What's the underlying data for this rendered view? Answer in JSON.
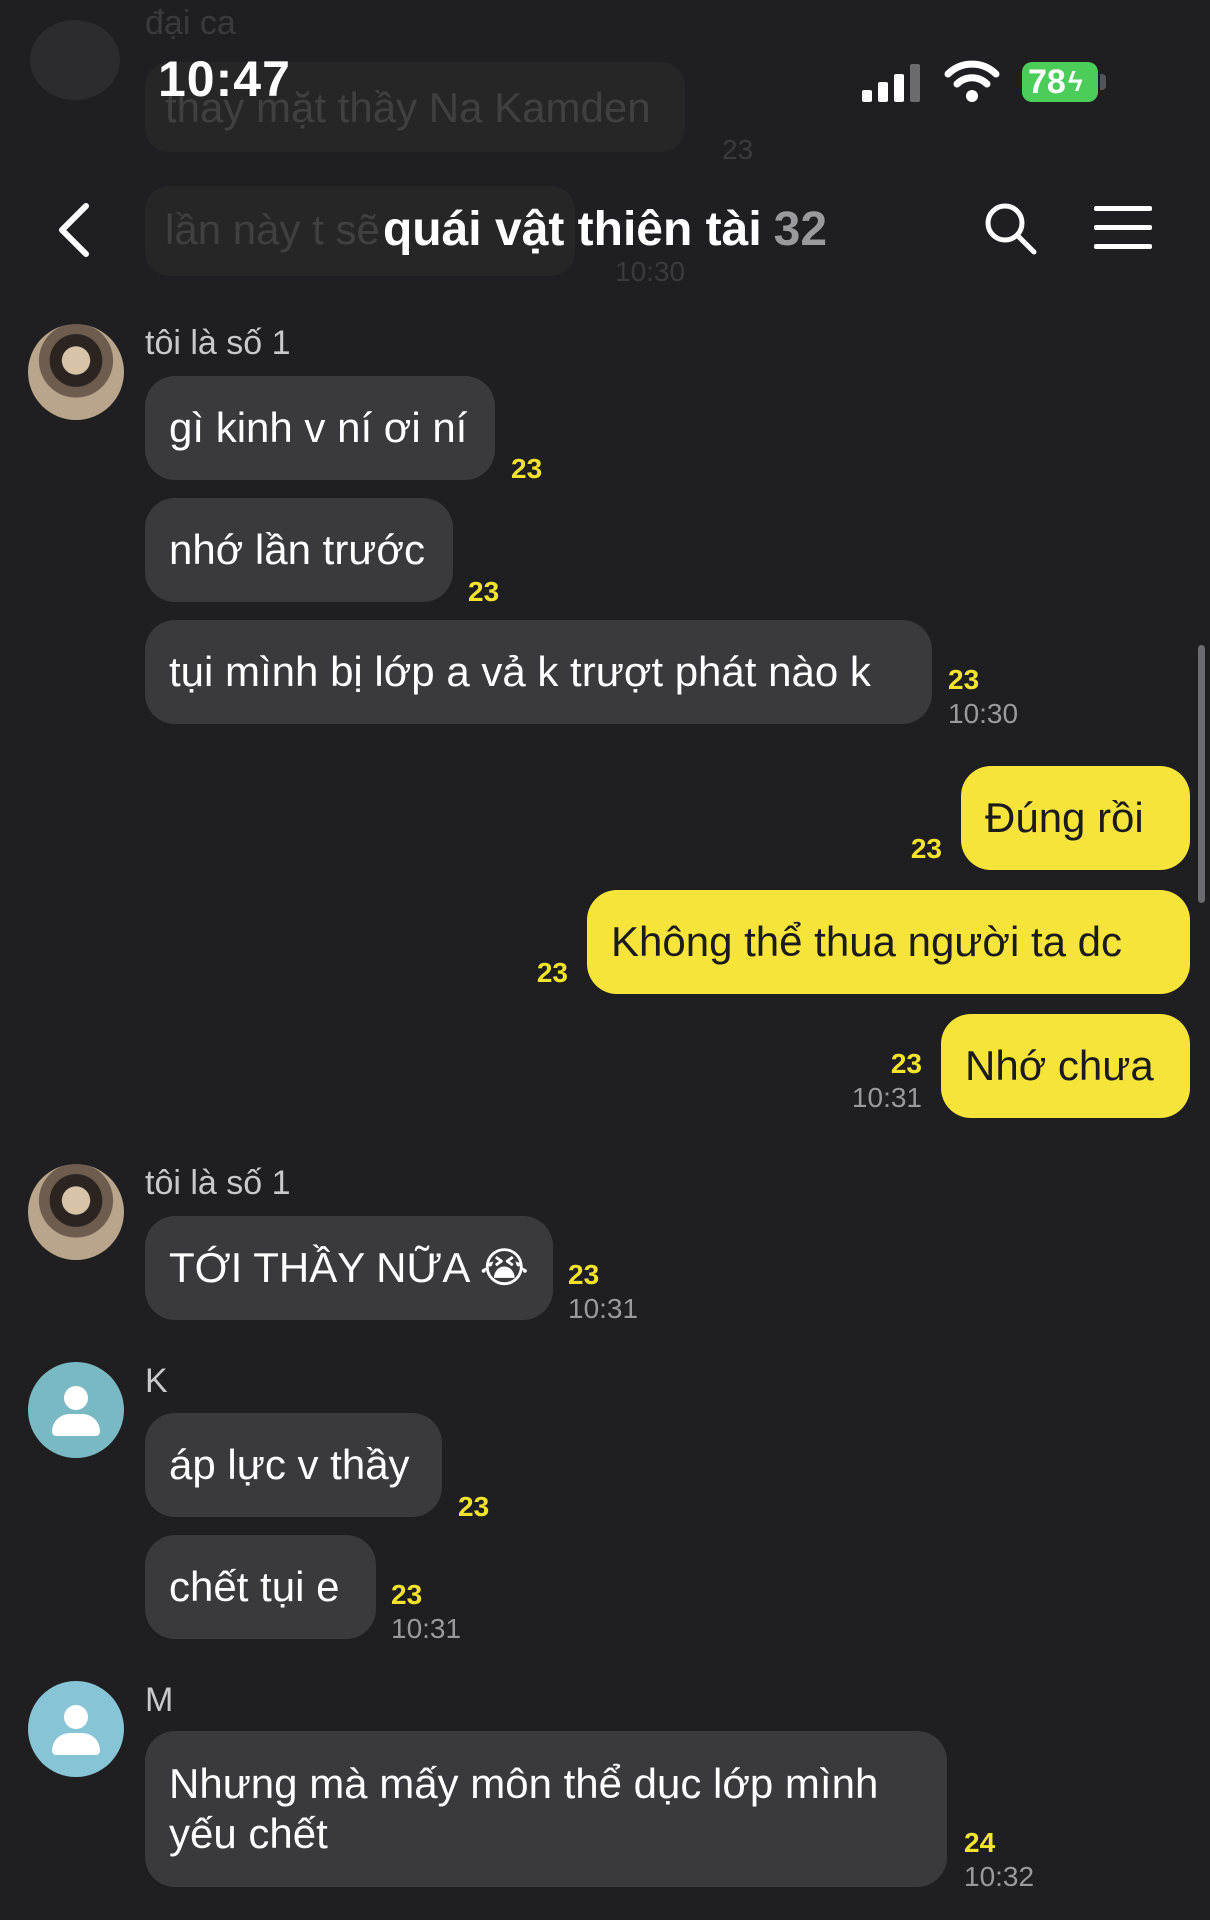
{
  "status_bar": {
    "time": "10:47",
    "battery": "78"
  },
  "header": {
    "title": "quái vật thiên tài",
    "member_count": "32"
  },
  "ghost": {
    "sender": "đại ca",
    "line1": "thay mặt thầy Na Kamden",
    "read1": "23",
    "line2": "lần này t sẽ",
    "time2": "10:30"
  },
  "messages": [
    {
      "sender": "tôi là số 1",
      "text": "gì kinh v ní ơi ní",
      "read": "23"
    },
    {
      "text": "nhớ lần trước",
      "read": "23"
    },
    {
      "text": "tụi mình bị lớp a vả k trượt phát nào k",
      "read": "23",
      "time": "10:30"
    },
    {
      "text": "Đúng rồi",
      "read": "23"
    },
    {
      "text": "Không thể thua người ta dc",
      "read": "23"
    },
    {
      "text": "Nhớ chưa",
      "read": "23",
      "time": "10:31"
    },
    {
      "sender": "tôi là số 1",
      "text": "TỚI THẦY NỮA 😭",
      "read": "23",
      "time": "10:31"
    },
    {
      "sender": "K",
      "text": "áp lực v thầy",
      "read": "23"
    },
    {
      "text": "chết tụi e",
      "read": "23",
      "time": "10:31"
    },
    {
      "sender": "M",
      "text": "Nhưng mà mấy môn thể dục lớp mình yếu chết",
      "read": "24",
      "time": "10:32"
    }
  ]
}
